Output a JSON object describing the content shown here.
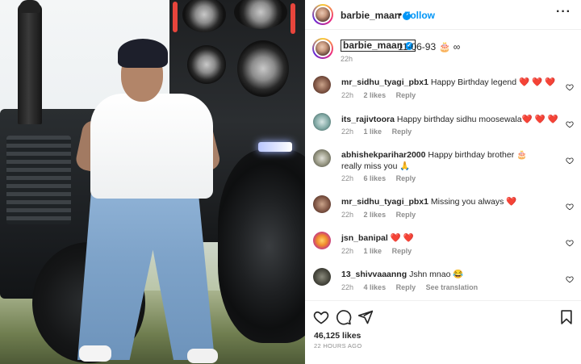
{
  "post": {
    "author": "barbie_maan",
    "follow_label": "Follow",
    "separator": "•",
    "more_label": "···",
    "caption": {
      "username": "barbie_maan",
      "text": "11-06-93 🎂 ∞",
      "time": "22h"
    },
    "likes": "46,125 likes",
    "time_ago": "22 HOURS AGO"
  },
  "comments": [
    {
      "username": "mr_sidhu_tyagi_pbx1",
      "text": "Happy Birthday legend ❤️ ❤️ ❤️",
      "time": "22h",
      "likes": "2 likes",
      "reply": "Reply",
      "translate": ""
    },
    {
      "username": "its_rajivtoora",
      "text": "Happy birthday sidhu moosewala❤️ ❤️ ❤️",
      "time": "22h",
      "likes": "1 like",
      "reply": "Reply",
      "translate": ""
    },
    {
      "username": "abhishekparihar2000",
      "text": "Happy birthday brother 🎂 really miss you 🙏",
      "time": "22h",
      "likes": "6 likes",
      "reply": "Reply",
      "translate": ""
    },
    {
      "username": "mr_sidhu_tyagi_pbx1",
      "text": "Missing you always ❤️",
      "time": "22h",
      "likes": "2 likes",
      "reply": "Reply",
      "translate": ""
    },
    {
      "username": "jsn_banipal",
      "text": "❤️ ❤️",
      "time": "22h",
      "likes": "1 like",
      "reply": "Reply",
      "translate": ""
    },
    {
      "username": "13_shivvaaanng",
      "text": "Jshn mnao 😂",
      "time": "22h",
      "likes": "4 likes",
      "reply": "Reply",
      "translate": "See translation"
    }
  ],
  "icons": {
    "like": "heart-icon",
    "comment": "comment-icon",
    "share": "share-icon",
    "save": "bookmark-icon",
    "verified": "verified-badge-icon",
    "comment_like": "heart-outline-icon"
  },
  "colors": {
    "accent": "#0095f6",
    "text": "#262626",
    "muted": "#8e8e8e",
    "heart": "#ed2a3b"
  }
}
